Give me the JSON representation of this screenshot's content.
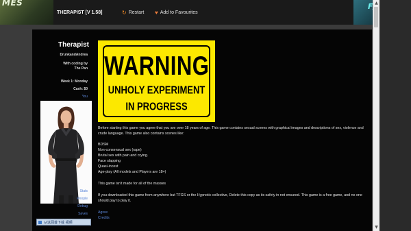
{
  "header": {
    "logo_left_text": "MES",
    "game_title": "THERAPIST [V 1.58]",
    "restart_label": "Restart",
    "favourites_label": "Add to Favourites",
    "logo_right_text": "F/"
  },
  "sidebar": {
    "title": "Therapist",
    "author": "DrunkandAndrea",
    "coding_line1": "With coding by",
    "coding_line2": "The Pan",
    "week": "Week 1: Monday",
    "cash": "Cash: $0",
    "you_link": "You",
    "links": [
      "Stats",
      "People",
      "Debug",
      "Saves"
    ],
    "taskbar_chip": "从这回首下载 视频"
  },
  "warning_sign": {
    "word": "WARNING",
    "line1": "UNHOLY EXPERIMENT",
    "line2": "IN PROGRESS"
  },
  "content": {
    "intro": "Before starting this game you agree that you are over 18 years of age. This game contains sexual scenes with graphical images and descriptions of sex, violence and crude language. This game also contains scenes like:",
    "items": [
      "BDSM",
      "Non-consensual sex (rape)",
      "Brutal sex with pain and crying.",
      "Face slapping",
      "Quasi-incest",
      "Age-play (All models and Players are 18+)"
    ],
    "not_for_all": "This game isn't made for all of the masses",
    "download_note": "If you downloaded this game from anywhere but TFGS or the Hypnotic collective, Delete this copy as its safety in not ensured. This game is a free game, and no one should pay to play it.",
    "agree_link": "Agree",
    "credits_link": "Credits"
  },
  "colors": {
    "background": "#3b3b3b",
    "panel": "#050505",
    "warning_yellow": "#fce800",
    "link_blue": "#5b86d9",
    "accent_orange": "#f08a24"
  }
}
